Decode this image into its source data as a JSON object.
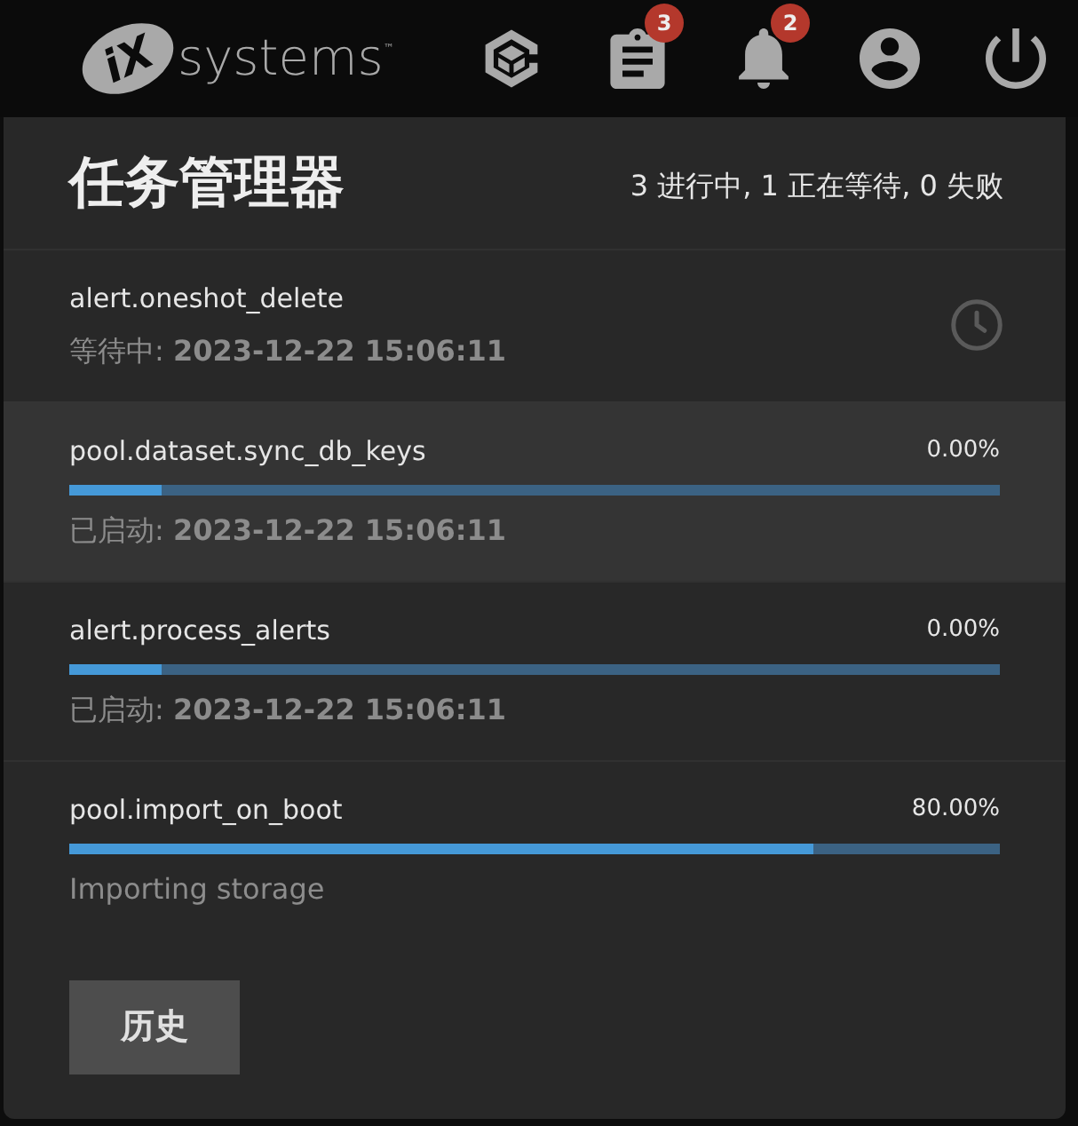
{
  "top_bar": {
    "logo": {
      "mark": "iX",
      "wordmark": "systems",
      "trademark": "™"
    },
    "icons": [
      {
        "kind": "cube"
      },
      {
        "kind": "clipboard",
        "badge": "3"
      },
      {
        "kind": "bell",
        "badge": "2"
      },
      {
        "kind": "account"
      },
      {
        "kind": "power"
      }
    ]
  },
  "task_manager": {
    "title": "任务管理器",
    "summary": "3 进行中, 1 正在等待, 0 失败",
    "tasks": [
      {
        "kind": "waiting",
        "name": "alert.oneshot_delete",
        "status": "等待中: **2023-12-22 15:06:11**",
        "selected": false
      },
      {
        "kind": "running",
        "name": "pool.dataset.sync_db_keys",
        "percent": "0.00%",
        "level": 0.1,
        "status": "已启动: **2023-12-22 15:06:11**",
        "selected": true
      },
      {
        "kind": "running",
        "name": "alert.process_alerts",
        "percent": "0.00%",
        "level": 0.1,
        "status": "已启动: **2023-12-22 15:06:11**",
        "selected": false
      },
      {
        "kind": "running",
        "name": "pool.import_on_boot",
        "percent": "80.00%",
        "level": 0.8,
        "status": "Importing storage",
        "selected": false
      }
    ],
    "history_button": "历史"
  }
}
